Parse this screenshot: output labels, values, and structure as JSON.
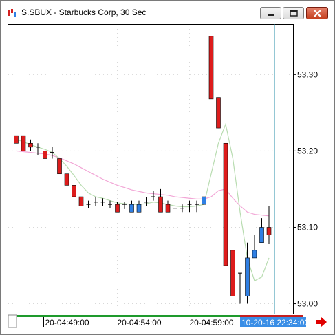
{
  "window": {
    "title": "S.SBUX - Starbucks Corp, 30 Sec",
    "buttons": {
      "minimize": "minimize",
      "maximize": "maximize",
      "close": "close"
    }
  },
  "chart_data": {
    "type": "candlestick",
    "symbol": "S.SBUX",
    "interval": "30 Sec",
    "y_ticks": [
      "53.30",
      "53.20",
      "53.10",
      "53.00"
    ],
    "y_tick_values": [
      53.3,
      53.2,
      53.1,
      53.0
    ],
    "ylim": [
      52.987,
      53.366
    ],
    "x_tick_labels": [
      "20-04:49:00",
      "20-04:54:00",
      "20-04:59:00"
    ],
    "x_tick_bar_index": [
      4,
      14,
      24
    ],
    "cursor_label": "10-20-16 22:34:00",
    "grid": true,
    "colors": {
      "up": "#2f7fe4",
      "down": "#dd1c1c",
      "doji": "#000000",
      "ma_fast": "#b8dcb0",
      "ma_slow": "#f2a6d6",
      "cursor": "#2a8fa8",
      "arrow": "#e00000"
    },
    "candles": [
      {
        "o": 53.22,
        "h": 53.22,
        "l": 53.21,
        "c": 53.21
      },
      {
        "o": 53.22,
        "h": 53.22,
        "l": 53.2,
        "c": 53.2
      },
      {
        "o": 53.21,
        "h": 53.215,
        "l": 53.2,
        "c": 53.205
      },
      {
        "o": 53.205,
        "h": 53.21,
        "l": 53.195,
        "c": 53.205
      },
      {
        "o": 53.2,
        "h": 53.205,
        "l": 53.19,
        "c": 53.19
      },
      {
        "o": 53.198,
        "h": 53.205,
        "l": 53.19,
        "c": 53.198
      },
      {
        "o": 53.19,
        "h": 53.19,
        "l": 53.17,
        "c": 53.17
      },
      {
        "o": 53.17,
        "h": 53.17,
        "l": 53.155,
        "c": 53.155
      },
      {
        "o": 53.155,
        "h": 53.155,
        "l": 53.14,
        "c": 53.14
      },
      {
        "o": 53.14,
        "h": 53.14,
        "l": 53.128,
        "c": 53.128
      },
      {
        "o": 53.13,
        "h": 53.135,
        "l": 53.125,
        "c": 53.13
      },
      {
        "o": 53.133,
        "h": 53.14,
        "l": 53.128,
        "c": 53.133
      },
      {
        "o": 53.133,
        "h": 53.138,
        "l": 53.128,
        "c": 53.133
      },
      {
        "o": 53.13,
        "h": 53.135,
        "l": 53.125,
        "c": 53.13
      },
      {
        "o": 53.13,
        "h": 53.133,
        "l": 53.12,
        "c": 53.12
      },
      {
        "o": 53.13,
        "h": 53.133,
        "l": 53.124,
        "c": 53.13
      },
      {
        "o": 53.12,
        "h": 53.135,
        "l": 53.12,
        "c": 53.13
      },
      {
        "o": 53.12,
        "h": 53.135,
        "l": 53.12,
        "c": 53.13
      },
      {
        "o": 53.133,
        "h": 53.14,
        "l": 53.128,
        "c": 53.133
      },
      {
        "o": 53.14,
        "h": 53.148,
        "l": 53.135,
        "c": 53.14
      },
      {
        "o": 53.14,
        "h": 53.15,
        "l": 53.12,
        "c": 53.12
      },
      {
        "o": 53.13,
        "h": 53.135,
        "l": 53.12,
        "c": 53.12
      },
      {
        "o": 53.125,
        "h": 53.13,
        "l": 53.12,
        "c": 53.125
      },
      {
        "o": 53.125,
        "h": 53.13,
        "l": 53.12,
        "c": 53.125
      },
      {
        "o": 53.13,
        "h": 53.135,
        "l": 53.12,
        "c": 53.13
      },
      {
        "o": 53.13,
        "h": 53.135,
        "l": 53.12,
        "c": 53.13
      },
      {
        "o": 53.13,
        "h": 53.14,
        "l": 53.13,
        "c": 53.14
      },
      {
        "o": 53.35,
        "h": 53.35,
        "l": 53.268,
        "c": 53.268
      },
      {
        "o": 53.27,
        "h": 53.27,
        "l": 53.23,
        "c": 53.23
      },
      {
        "o": 53.21,
        "h": 53.21,
        "l": 53.05,
        "c": 53.05
      },
      {
        "o": 53.07,
        "h": 53.07,
        "l": 53.0,
        "c": 53.01
      },
      {
        "o": 53.04,
        "h": 53.04,
        "l": 53.0,
        "c": 53.04
      },
      {
        "o": 53.01,
        "h": 53.08,
        "l": 53.0,
        "c": 53.06
      },
      {
        "o": 53.06,
        "h": 53.09,
        "l": 53.06,
        "c": 53.07
      },
      {
        "o": 53.08,
        "h": 53.112,
        "l": 53.08,
        "c": 53.1
      },
      {
        "o": 53.1,
        "h": 53.128,
        "l": 53.078,
        "c": 53.09
      }
    ],
    "ma_fast": [
      53.215,
      53.212,
      53.208,
      53.205,
      53.202,
      53.198,
      53.19,
      53.18,
      53.168,
      53.155,
      53.145,
      53.14,
      53.138,
      53.135,
      53.132,
      53.131,
      53.13,
      53.13,
      53.131,
      53.133,
      53.132,
      53.13,
      53.128,
      53.127,
      53.127,
      53.128,
      53.13,
      53.17,
      53.21,
      53.235,
      53.19,
      53.12,
      53.06,
      53.03,
      53.035,
      53.06
    ],
    "ma_slow": [
      53.2,
      53.199,
      53.198,
      53.197,
      53.196,
      53.194,
      53.191,
      53.187,
      53.183,
      53.178,
      53.173,
      53.168,
      53.163,
      53.159,
      53.155,
      53.152,
      53.149,
      53.147,
      53.145,
      53.144,
      53.143,
      53.142,
      53.14,
      53.139,
      53.138,
      53.137,
      53.137,
      53.14,
      53.148,
      53.15,
      53.138,
      53.128,
      53.12,
      53.117,
      53.116,
      53.115
    ]
  }
}
